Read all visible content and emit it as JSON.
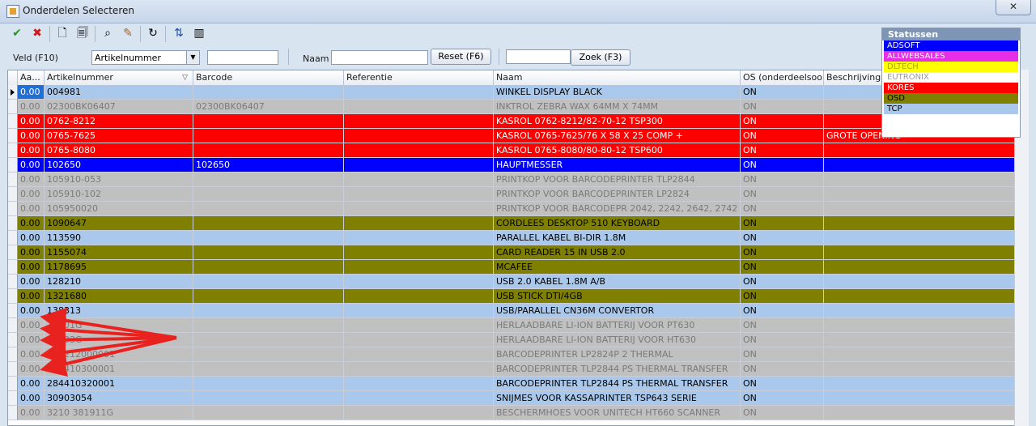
{
  "window": {
    "title": "Onderdelen Selecteren",
    "close_label": "✕"
  },
  "toolbar": {
    "buttons": [
      {
        "name": "confirm-icon",
        "glyph": "✔"
      },
      {
        "name": "cancel-icon",
        "glyph": "✖"
      },
      {
        "name": "new-document-icon",
        "glyph": "🗋"
      },
      {
        "name": "copy-document-icon",
        "glyph": "🗐"
      },
      {
        "name": "find-icon",
        "glyph": "⌕"
      },
      {
        "name": "filter-icon",
        "glyph": "✎"
      },
      {
        "name": "refresh-icon",
        "glyph": "↻"
      },
      {
        "name": "sort-az-icon",
        "glyph": "⇅"
      },
      {
        "name": "columns-icon",
        "glyph": "▥"
      }
    ]
  },
  "search": {
    "field_label": "Veld (F10)",
    "field_value": "Artikelnummer",
    "field_text": "",
    "naam_label": "Naam",
    "naam_value": "",
    "reset_label": "Reset (F6)",
    "zoek_value": "",
    "zoek_label": "Zoek (F3)"
  },
  "columns": [
    "Aa...",
    "Artikelnummer",
    "Barcode",
    "Referentie",
    "Naam",
    "OS (onderdeelsoort)",
    "Beschrijving"
  ],
  "statuses": {
    "title": "Statussen",
    "items": [
      {
        "label": "ADSOFT",
        "bg": "#0000ff",
        "fg": "#ffffff"
      },
      {
        "label": "ALLWEBSALES",
        "bg": "#e62ee6",
        "fg": "#ffffff"
      },
      {
        "label": "DLTECH",
        "bg": "#ffff00",
        "fg": "#a8a800"
      },
      {
        "label": "EUTRONIX",
        "bg": "#ffffff",
        "fg": "#9a9a9a"
      },
      {
        "label": "KORES",
        "bg": "#ff0000",
        "fg": "#ffffff"
      },
      {
        "label": "OSD",
        "bg": "#808000",
        "fg": "#000000"
      },
      {
        "label": "TCP",
        "bg": "#a9c8ec",
        "fg": "#000000"
      }
    ]
  },
  "colors": {
    "tcp": "#a9c8ec",
    "gray": "#c0c0c0",
    "kores": "#ff0000",
    "adsoft": "#0000ff",
    "osd": "#808000",
    "arrow": "#e8221e"
  },
  "rows": [
    {
      "aa": "0.00",
      "art": "004981",
      "barcode": "",
      "ref": "",
      "naam": "WINKEL DISPLAY BLACK",
      "os": "ON",
      "besch": "",
      "bg": "#a9c8ec",
      "fg": "#000000",
      "selected": true
    },
    {
      "aa": "0.00",
      "art": "02300BK06407",
      "barcode": "02300BK06407",
      "ref": "",
      "naam": "INKTROL ZEBRA WAX 64MM X 74MM",
      "os": "ON",
      "besch": "",
      "bg": "#c0c0c0",
      "fg": "#7a7a7a"
    },
    {
      "aa": "0.00",
      "art": "0762-8212",
      "barcode": "",
      "ref": "",
      "naam": "KASROL 0762-8212/82-70-12 TSP300",
      "os": "ON",
      "besch": "",
      "bg": "#ff0000",
      "fg": "#ffffff"
    },
    {
      "aa": "0.00",
      "art": "0765-7625",
      "barcode": "",
      "ref": "",
      "naam": "KASROL 0765-7625/76 X 58 X 25 COMP +",
      "os": "ON",
      "besch": "GROTE OPENING",
      "bg": "#ff0000",
      "fg": "#ffffff"
    },
    {
      "aa": "0.00",
      "art": "0765-8080",
      "barcode": "",
      "ref": "",
      "naam": "KASROL 0765-8080/80-80-12 TSP600",
      "os": "ON",
      "besch": "",
      "bg": "#ff0000",
      "fg": "#ffffff"
    },
    {
      "aa": "0.00",
      "art": "102650",
      "barcode": "102650",
      "ref": "",
      "naam": "HAUPTMESSER",
      "os": "ON",
      "besch": "",
      "bg": "#0000ff",
      "fg": "#ffffff"
    },
    {
      "aa": "0.00",
      "art": "105910-053",
      "barcode": "",
      "ref": "",
      "naam": "PRINTKOP VOOR BARCODEPRINTER TLP2844",
      "os": "ON",
      "besch": "",
      "bg": "#c0c0c0",
      "fg": "#7a7a7a"
    },
    {
      "aa": "0.00",
      "art": "105910-102",
      "barcode": "",
      "ref": "",
      "naam": "PRINTKOP VOOR BARCODEPRINTER  LP2824",
      "os": "ON",
      "besch": "",
      "bg": "#c0c0c0",
      "fg": "#7a7a7a"
    },
    {
      "aa": "0.00",
      "art": "105950020",
      "barcode": "",
      "ref": "",
      "naam": "PRINTKOP VOOR BARCODEPR 2042, 2242, 2642, 2742",
      "os": "ON",
      "besch": "",
      "bg": "#c0c0c0",
      "fg": "#7a7a7a"
    },
    {
      "aa": "0.00",
      "art": "1090647",
      "barcode": "",
      "ref": "",
      "naam": "CORDLEES DESKTOP 510 KEYBOARD",
      "os": "ON",
      "besch": "",
      "bg": "#808000",
      "fg": "#000000"
    },
    {
      "aa": "0.00",
      "art": "113590",
      "barcode": "",
      "ref": "",
      "naam": "PARALLEL KABEL BI-DIR 1.8M",
      "os": "ON",
      "besch": "",
      "bg": "#a9c8ec",
      "fg": "#000000"
    },
    {
      "aa": "0.00",
      "art": "1155074",
      "barcode": "",
      "ref": "",
      "naam": "CARD READER 15 IN USB 2.0",
      "os": "ON",
      "besch": "",
      "bg": "#808000",
      "fg": "#000000"
    },
    {
      "aa": "0.00",
      "art": "1178695",
      "barcode": "",
      "ref": "",
      "naam": "MCAFEE",
      "os": "ON",
      "besch": "",
      "bg": "#808000",
      "fg": "#000000"
    },
    {
      "aa": "0.00",
      "art": "128210",
      "barcode": "",
      "ref": "",
      "naam": "USB 2.0 KABEL 1.8M A/B",
      "os": "ON",
      "besch": "",
      "bg": "#a9c8ec",
      "fg": "#000000"
    },
    {
      "aa": "0.00",
      "art": "1321680",
      "barcode": "",
      "ref": "",
      "naam": "USB STICK DTI/4GB",
      "os": "ON",
      "besch": "",
      "bg": "#808000",
      "fg": "#000000"
    },
    {
      "aa": "0.00",
      "art": "138313",
      "barcode": "",
      "ref": "",
      "naam": "USB/PARALLEL CN36M CONVERTOR",
      "os": "ON",
      "besch": "",
      "bg": "#a9c8ec",
      "fg": "#000000"
    },
    {
      "aa": "0.00",
      "art": "18501G",
      "barcode": "",
      "ref": "",
      "naam": "HERLAADBARE LI-ION BATTERIJ VOOR PT630",
      "os": "ON",
      "besch": "",
      "bg": "#c0c0c0",
      "fg": "#7a7a7a"
    },
    {
      "aa": "0.00",
      "art": "18503G",
      "barcode": "",
      "ref": "",
      "naam": "HERLAADBARE LI-ION BATTERIJ VOOR  HT630",
      "os": "ON",
      "besch": "",
      "bg": "#c0c0c0",
      "fg": "#7a7a7a"
    },
    {
      "aa": "0.00",
      "art": "284212000001",
      "barcode": "",
      "ref": "",
      "naam": "BARCODEPRINTER LP2824P 2 THERMAL",
      "os": "ON",
      "besch": "",
      "bg": "#c0c0c0",
      "fg": "#7a7a7a"
    },
    {
      "aa": "0.00",
      "art": "284410300001",
      "barcode": "",
      "ref": "",
      "naam": "BARCODEPRINTER TLP2844 PS THERMAL TRANSFER",
      "os": "ON",
      "besch": "",
      "bg": "#c0c0c0",
      "fg": "#7a7a7a"
    },
    {
      "aa": "0.00",
      "art": "284410320001",
      "barcode": "",
      "ref": "",
      "naam": "BARCODEPRINTER TLP2844 PS THERMAL TRANSFER",
      "os": "ON",
      "besch": "",
      "bg": "#a9c8ec",
      "fg": "#000000"
    },
    {
      "aa": "0.00",
      "art": "30903054",
      "barcode": "",
      "ref": "",
      "naam": "SNIJMES VOOR KASSAPRINTER TSP643 SERIE",
      "os": "ON",
      "besch": "",
      "bg": "#a9c8ec",
      "fg": "#000000"
    },
    {
      "aa": "0.00",
      "art": "3210 381911G",
      "barcode": "",
      "ref": "",
      "naam": "BESCHERMHOES VOOR UNITECH HT660 SCANNER",
      "os": "ON",
      "besch": "",
      "bg": "#c0c0c0",
      "fg": "#7a7a7a"
    }
  ]
}
